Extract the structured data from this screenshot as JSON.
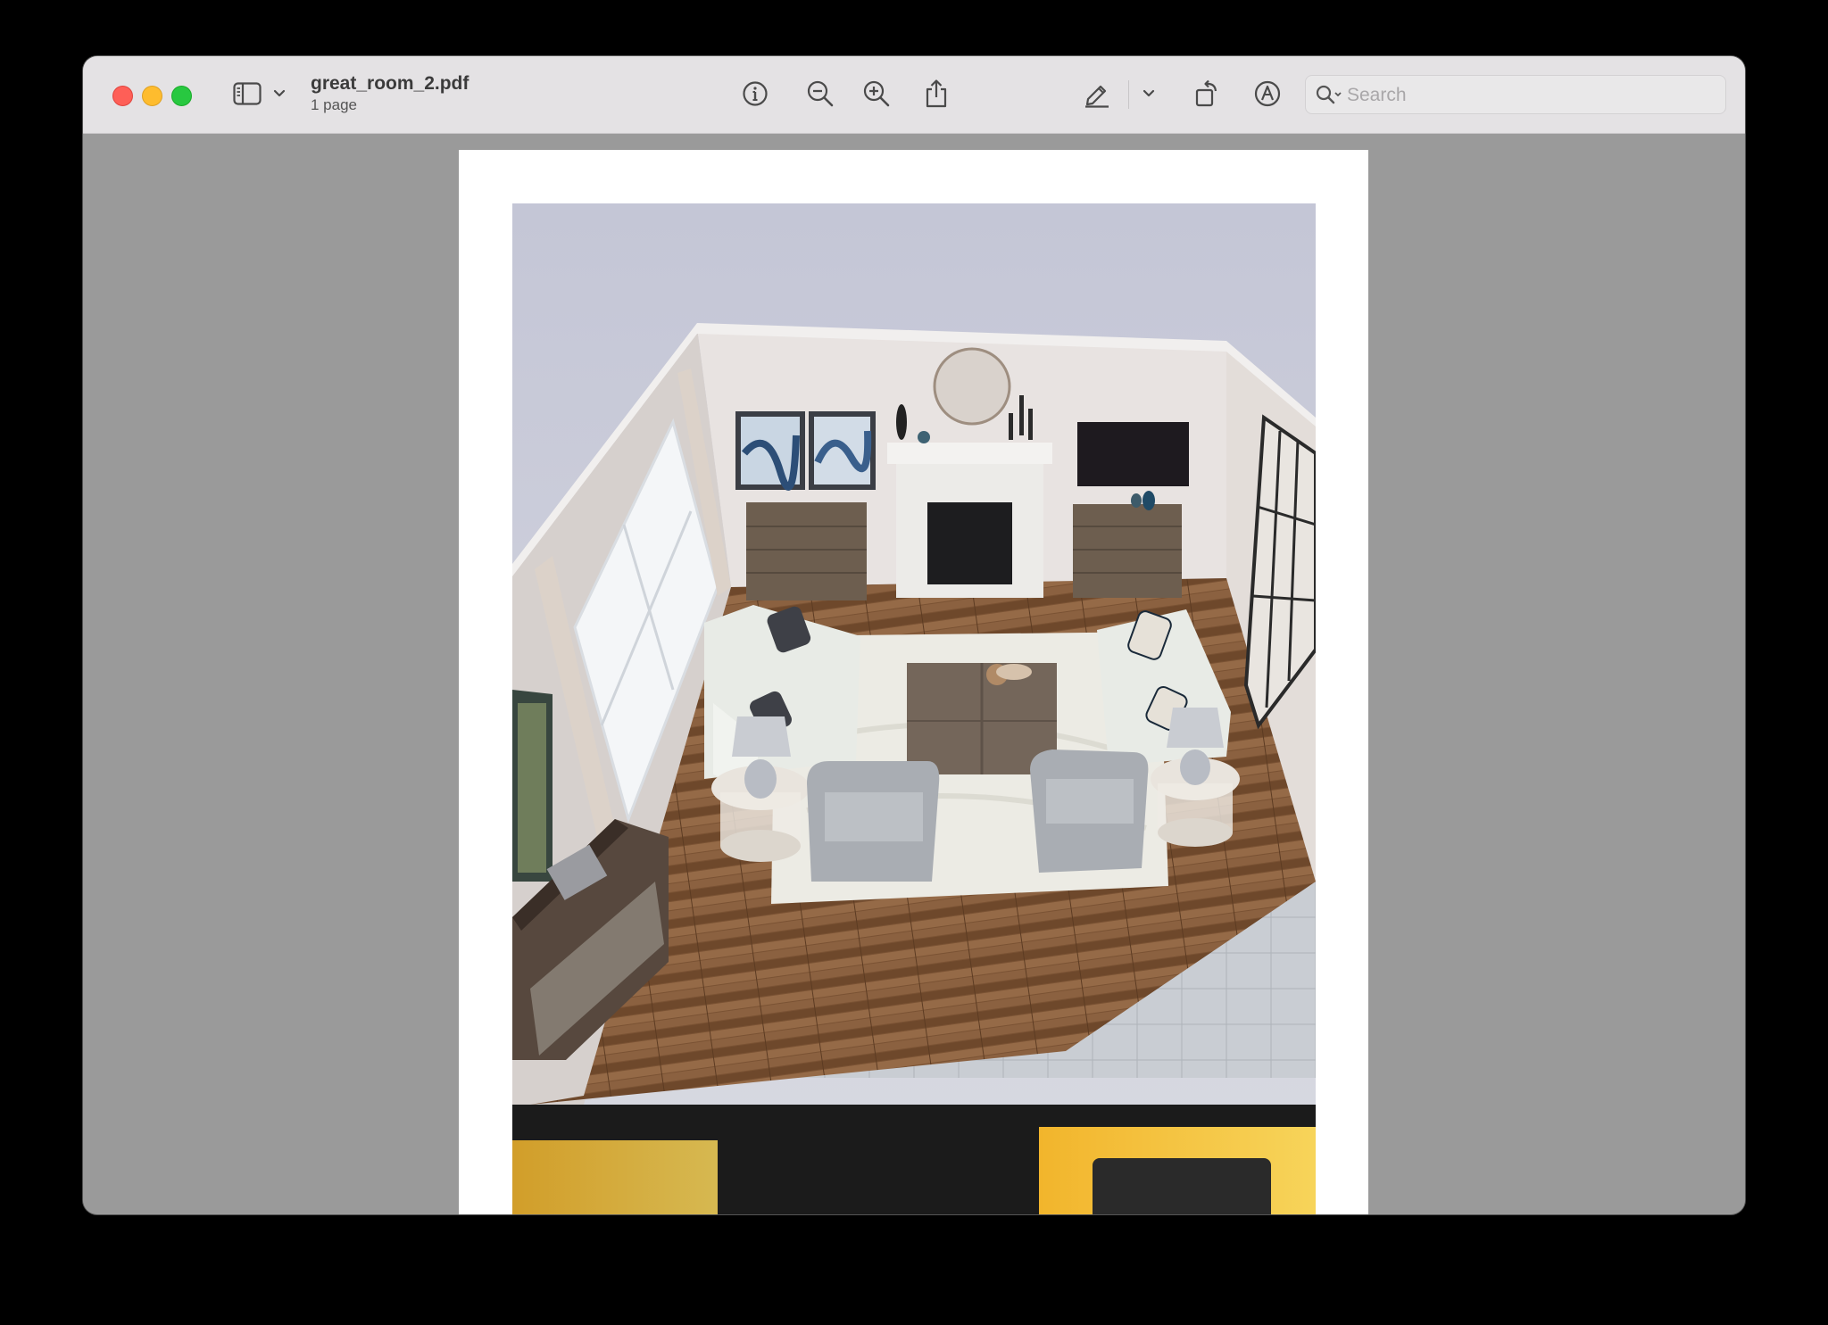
{
  "window": {
    "title": "great_room_2.pdf",
    "subtitle": "1 page"
  },
  "toolbar": {
    "sidebar_icon": "sidebar-icon",
    "sidebar_menu_icon": "chevron-down-icon",
    "info_icon": "info-icon",
    "zoom_out_icon": "zoom-out-icon",
    "zoom_in_icon": "zoom-in-icon",
    "share_icon": "share-icon",
    "highlight_icon": "pencil-icon",
    "highlight_menu_icon": "chevron-down-icon",
    "rotate_icon": "rotate-icon",
    "markup_icon": "markup-icon",
    "form_fill_icon": "form-fill-icon"
  },
  "search": {
    "placeholder": "Search",
    "value": ""
  },
  "document": {
    "image_name": "isometric-room-rendering"
  },
  "colors": {
    "window_bg": "#9a9a9a",
    "toolbar_bg": "#e4e2e4",
    "close": "#fe5f57",
    "minimize": "#febc2e",
    "maximize": "#28c840"
  }
}
